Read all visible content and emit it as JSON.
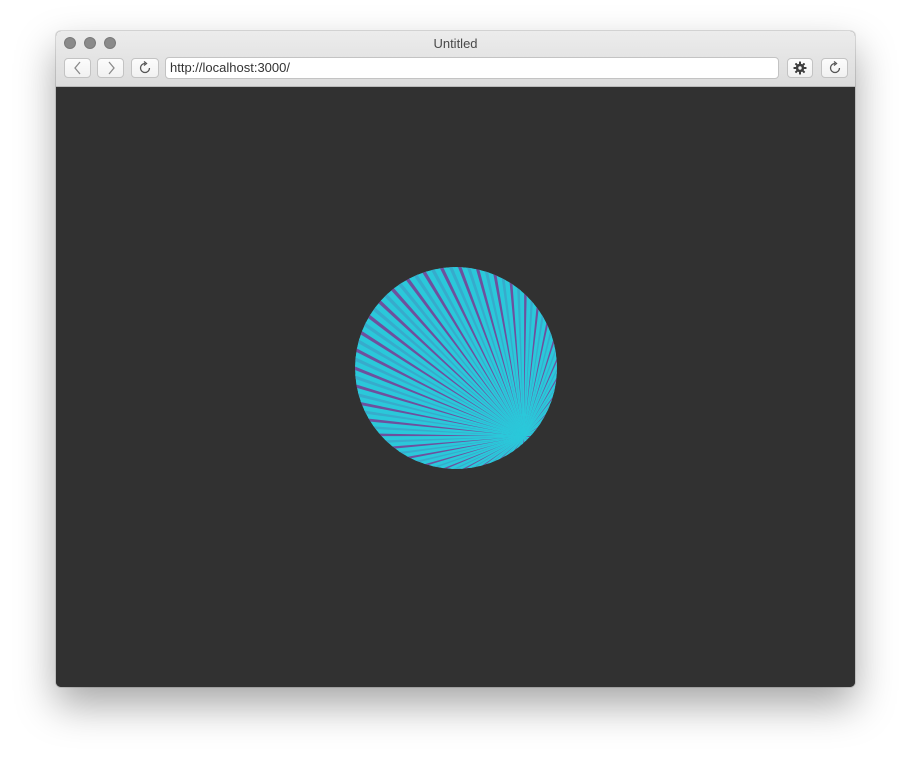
{
  "window": {
    "title": "Untitled"
  },
  "toolbar": {
    "url": "http://localhost:3000/"
  },
  "icons": {
    "back": "chevron-left-icon",
    "forward": "chevron-right-icon",
    "reload": "reload-icon",
    "settings": "gear-icon"
  },
  "colors": {
    "page_background": "#313131",
    "ray_primary": "#2bc8da",
    "ray_secondary": "#7a3b93"
  }
}
